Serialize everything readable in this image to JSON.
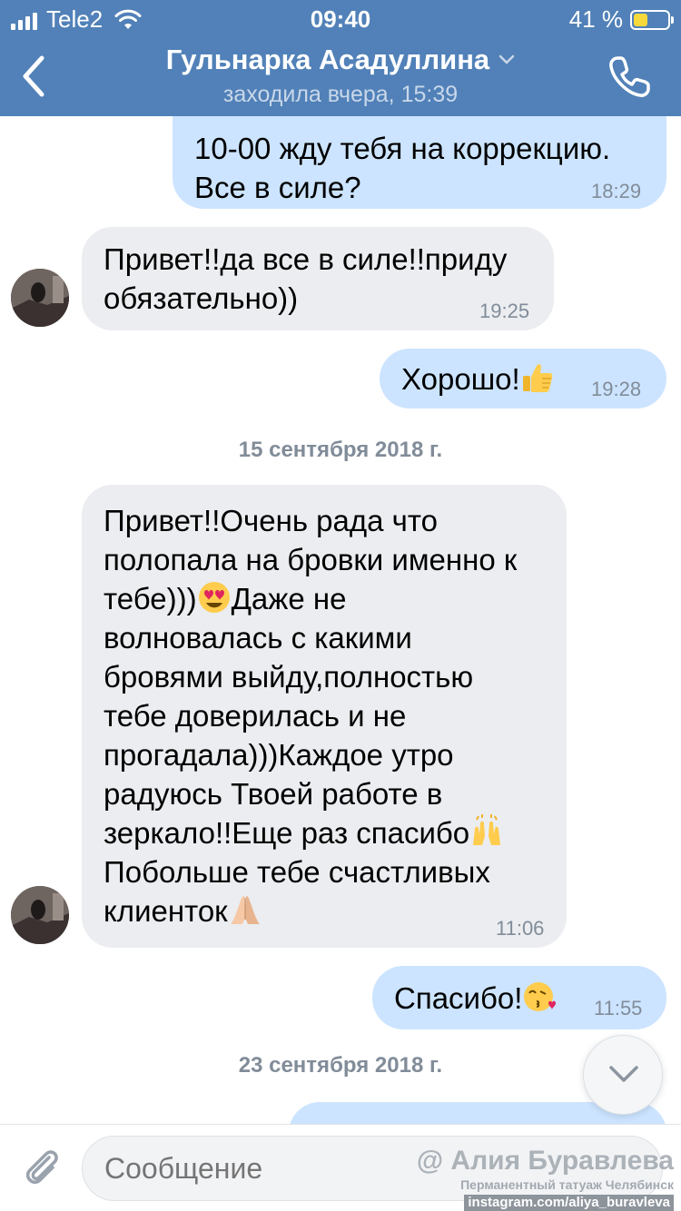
{
  "status_bar": {
    "carrier": "Tele2",
    "time": "09:40",
    "battery": "41 %",
    "battery_level": 0.41
  },
  "header": {
    "title": "Гульнарка Асадуллина",
    "subtitle": "заходила вчера, 15:39"
  },
  "messages": [
    {
      "direction": "out",
      "lines": [
        "10-00 жду тебя на коррекцию.",
        "Все в силе?"
      ],
      "time": "18:29"
    },
    {
      "direction": "in",
      "lines": [
        "Привет!!да все в силе!!приду",
        "обязательно))"
      ],
      "time": "19:25"
    },
    {
      "direction": "out",
      "text": "Хорошо!",
      "emoji": "thumbs-up",
      "time": "19:28"
    },
    {
      "date": "15 сентября 2018 г."
    },
    {
      "direction": "in",
      "lines": [
        "Привет!!Очень рада что",
        "полопала на бровки именно к",
        "тебе)))",
        "Даже не",
        "волновалась с какими",
        "бровями выйду,полностью",
        "тебе доверилась и не",
        "прогадала)))Каждое утро",
        "радуюсь Твоей работе в",
        "зеркало!!Еще раз спасибо",
        "Побольше тебе счастливых",
        "клиенток"
      ],
      "emojis": [
        "heart-eyes",
        "raised-hands",
        "folded-hands"
      ],
      "time": "11:06"
    },
    {
      "direction": "out",
      "text": "Спасибо!",
      "emoji": "kissing-heart",
      "time": "11:55"
    },
    {
      "date": "23 сентября 2018 г."
    }
  ],
  "composer": {
    "placeholder": "Сообщение"
  },
  "watermark": {
    "line1": "@ Алия Буравлева",
    "line2": "Перманентный татуаж Челябинск",
    "line3": "instagram.com/aliya_buravleva"
  },
  "colors": {
    "header": "#5181b8",
    "outgoing_bubble": "#cce4ff",
    "incoming_bubble": "#ebedf0",
    "meta_text": "#818c99"
  }
}
